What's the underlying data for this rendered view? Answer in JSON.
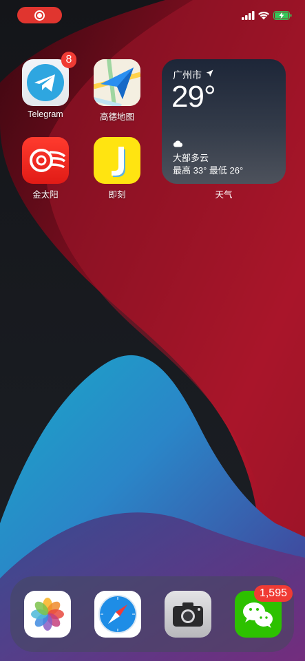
{
  "status_bar": {
    "screen_recording": true,
    "signal_bars": 4,
    "wifi": "full",
    "battery": "charging"
  },
  "home": {
    "apps": [
      {
        "name": "Telegram",
        "label": "Telegram",
        "badge": "8",
        "icon": "telegram-icon"
      },
      {
        "name": "amap",
        "label": "高德地图",
        "icon": "amap-icon"
      },
      {
        "name": "jintaiyang",
        "label": "金太阳",
        "icon": "jintaiyang-icon"
      },
      {
        "name": "jike",
        "label": "即刻",
        "icon": "jike-icon"
      }
    ],
    "weather_widget": {
      "city": "广州市",
      "temperature": "29°",
      "condition": "大部多云",
      "range": "最高 33° 最低 26°",
      "label": "天气"
    }
  },
  "dock": {
    "apps": [
      {
        "name": "Photos",
        "icon": "photos-icon"
      },
      {
        "name": "Safari",
        "icon": "safari-icon"
      },
      {
        "name": "Camera",
        "icon": "camera-icon"
      },
      {
        "name": "WeChat",
        "badge": "1,595",
        "icon": "wechat-icon"
      }
    ]
  },
  "colors": {
    "badge": "#f03b34",
    "record_pill": "#e0352f",
    "battery_green": "#35c759"
  }
}
